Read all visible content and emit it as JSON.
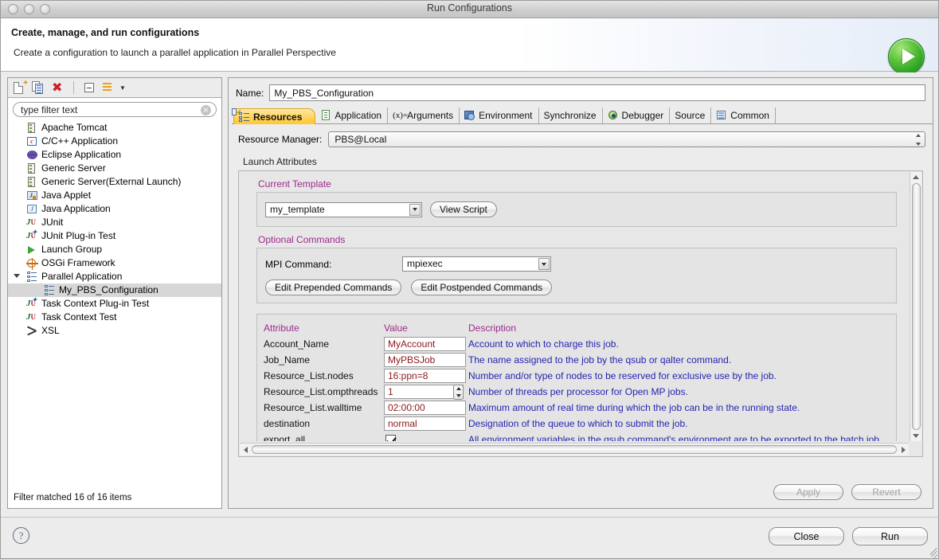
{
  "window": {
    "title": "Run Configurations"
  },
  "header": {
    "title": "Create, manage, and run configurations",
    "subtitle": "Create a configuration to launch a parallel application in Parallel Perspective",
    "badge_icon": "run-play-icon"
  },
  "sidebar": {
    "toolbar": [
      {
        "name": "new-launch-configuration-icon",
        "label": "New launch configuration"
      },
      {
        "name": "duplicate-launch-configuration-icon",
        "label": "Duplicate"
      },
      {
        "name": "delete-launch-configuration-icon",
        "label": "Delete"
      },
      {
        "name": "collapse-all-icon",
        "label": "Collapse All"
      },
      {
        "name": "filter-launch-configurations-icon",
        "label": "Filter"
      }
    ],
    "filter": {
      "value": "type filter text",
      "placeholder": "type filter text",
      "clear_icon": "clear-icon"
    },
    "tree": [
      {
        "label": "Apache Tomcat",
        "icon": "server-icon",
        "indent": 0,
        "selected": false
      },
      {
        "label": "C/C++ Application",
        "icon": "c-application-icon",
        "indent": 0,
        "selected": false
      },
      {
        "label": "Eclipse Application",
        "icon": "eclipse-icon",
        "indent": 0,
        "selected": false
      },
      {
        "label": "Generic Server",
        "icon": "server-icon",
        "indent": 0,
        "selected": false
      },
      {
        "label": "Generic Server(External Launch)",
        "icon": "server-icon",
        "indent": 0,
        "selected": false
      },
      {
        "label": "Java Applet",
        "icon": "java-applet-icon",
        "indent": 0,
        "selected": false
      },
      {
        "label": "Java Application",
        "icon": "java-application-icon",
        "indent": 0,
        "selected": false
      },
      {
        "label": "JUnit",
        "icon": "junit-icon",
        "indent": 0,
        "selected": false
      },
      {
        "label": "JUnit Plug-in Test",
        "icon": "junit-plugin-icon",
        "indent": 0,
        "selected": false
      },
      {
        "label": "Launch Group",
        "icon": "launch-group-icon",
        "indent": 0,
        "selected": false
      },
      {
        "label": "OSGi Framework",
        "icon": "osgi-icon",
        "indent": 0,
        "selected": false
      },
      {
        "label": "Parallel Application",
        "icon": "parallel-application-icon",
        "indent": 0,
        "selected": false,
        "expanded": true
      },
      {
        "label": "My_PBS_Configuration",
        "icon": "parallel-application-icon",
        "indent": 1,
        "selected": true
      },
      {
        "label": "Task Context Plug-in Test",
        "icon": "junit-plugin-icon",
        "indent": 0,
        "selected": false
      },
      {
        "label": "Task Context Test",
        "icon": "junit-icon",
        "indent": 0,
        "selected": false
      },
      {
        "label": "XSL",
        "icon": "xsl-icon",
        "indent": 0,
        "selected": false
      }
    ],
    "status": "Filter matched 16 of 16 items"
  },
  "main": {
    "name_label": "Name:",
    "name_value": "My_PBS_Configuration",
    "tabs": [
      {
        "label": "Resources",
        "icon": "resources-icon",
        "active": true
      },
      {
        "label": "Application",
        "icon": "application-doc-icon",
        "active": false
      },
      {
        "label": "Arguments",
        "icon": "arguments-icon",
        "icon_text": "(x)=",
        "active": false
      },
      {
        "label": "Environment",
        "icon": "environment-icon",
        "active": false
      },
      {
        "label": "Synchronize",
        "icon": "",
        "active": false
      },
      {
        "label": "Debugger",
        "icon": "debugger-bug-icon",
        "active": false
      },
      {
        "label": "Source",
        "icon": "source-icon",
        "active": false
      },
      {
        "label": "Common",
        "icon": "common-icon",
        "active": false
      }
    ],
    "resource_manager": {
      "label": "Resource Manager:",
      "value": "PBS@Local"
    },
    "launch_attributes_label": "Launch Attributes",
    "current_template": {
      "title": "Current Template",
      "value": "my_template",
      "view_script_button": "View Script"
    },
    "optional_commands": {
      "title": "Optional Commands",
      "mpi_label": "MPI Command:",
      "mpi_value": "mpiexec",
      "prepended_button": "Edit Prepended Commands",
      "postpended_button": "Edit Postpended Commands"
    },
    "attributes_table": {
      "columns": [
        "Attribute",
        "Value",
        "Description"
      ],
      "rows": [
        {
          "attribute": "Account_Name",
          "value": "MyAccount",
          "type": "text",
          "description": "Account to which to charge this job."
        },
        {
          "attribute": "Job_Name",
          "value": "MyPBSJob",
          "type": "text",
          "description": "The name assigned to the job by the qsub or qalter command."
        },
        {
          "attribute": "Resource_List.nodes",
          "value": "16:ppn=8",
          "type": "text",
          "description": "Number and/or type of nodes to be reserved for exclusive use by the job."
        },
        {
          "attribute": "Resource_List.ompthreads",
          "value": "1",
          "type": "spinner",
          "description": "Number of threads per processor for Open MP jobs."
        },
        {
          "attribute": "Resource_List.walltime",
          "value": "02:00:00",
          "type": "text",
          "description": "Maximum amount of real time during which the job can be in the running state."
        },
        {
          "attribute": "destination",
          "value": "normal",
          "type": "text",
          "description": "Designation of the queue to which to submit the job."
        },
        {
          "attribute": "export_all",
          "value": "checked",
          "type": "checkbox",
          "description": "All environment variables in the qsub command's environment are to be exported to the batch job."
        }
      ]
    },
    "apply_button": "Apply",
    "revert_button": "Revert"
  },
  "footer": {
    "help_icon": "help-icon",
    "close_button": "Close",
    "run_button": "Run"
  },
  "colors": {
    "accent_magenta": "#9c2a8c",
    "description_blue": "#2424b0",
    "value_maroon": "#8b1a1a",
    "active_tab": "#ffd45e",
    "run_badge_green": "#239b1e",
    "selection_gray": "#d7d7d7"
  }
}
